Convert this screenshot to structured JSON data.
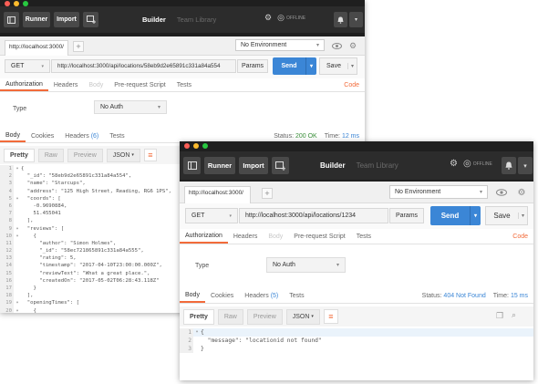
{
  "toolbar": {
    "runner_label": "Runner",
    "import_label": "Import",
    "builder_tab": "Builder",
    "team_library_tab": "Team Library",
    "offline_label": "OFFLINE"
  },
  "window1": {
    "url_tab": "http://localhost:3000/",
    "environment": "No Environment",
    "method": "GET",
    "url": "http://localhost:3000/api/locations/58eb9d2e65891c331a84a554",
    "params_label": "Params",
    "send_label": "Send",
    "save_label": "Save",
    "request_tabs": [
      "Authorization",
      "Headers",
      "Body",
      "Pre-request Script",
      "Tests"
    ],
    "code_link": "Code",
    "type_label": "Type",
    "auth_value": "No Auth",
    "response_tabs": [
      "Body",
      "Cookies",
      "Headers",
      "Tests"
    ],
    "headers_count": "(6)",
    "status_label": "Status:",
    "status_value": "200 OK",
    "time_label": "Time:",
    "time_value": "12 ms",
    "format_buttons": [
      "Pretty",
      "Raw",
      "Preview"
    ],
    "format_select": "JSON",
    "code_lines": [
      {
        "n": "1",
        "fold": "▾",
        "text": "{"
      },
      {
        "n": "2",
        "fold": "",
        "text": "  \"_id\": \"58eb9d2e65891c331a84a554\","
      },
      {
        "n": "3",
        "fold": "",
        "text": "  \"name\": \"Starcups\","
      },
      {
        "n": "4",
        "fold": "",
        "text": "  \"address\": \"125 High Street, Reading, RG6 1PS\","
      },
      {
        "n": "5",
        "fold": "▾",
        "text": "  \"coords\": ["
      },
      {
        "n": "6",
        "fold": "",
        "text": "    -0.9690884,"
      },
      {
        "n": "7",
        "fold": "",
        "text": "    51.455041"
      },
      {
        "n": "8",
        "fold": "",
        "text": "  ],"
      },
      {
        "n": "9",
        "fold": "▾",
        "text": "  \"reviews\": ["
      },
      {
        "n": "10",
        "fold": "▾",
        "text": "    {"
      },
      {
        "n": "11",
        "fold": "",
        "text": "      \"author\": \"Simon Holmes\","
      },
      {
        "n": "12",
        "fold": "",
        "text": "      \"_id\": \"58ec721865891c331a84a555\","
      },
      {
        "n": "13",
        "fold": "",
        "text": "      \"rating\": 5,"
      },
      {
        "n": "14",
        "fold": "",
        "text": "      \"timestamp\": \"2017-04-10T23:00:00.000Z\","
      },
      {
        "n": "15",
        "fold": "",
        "text": "      \"reviewText\": \"What a great place.\","
      },
      {
        "n": "16",
        "fold": "",
        "text": "      \"createdOn\": \"2017-05-02T06:28:43.118Z\""
      },
      {
        "n": "17",
        "fold": "",
        "text": "    }"
      },
      {
        "n": "18",
        "fold": "",
        "text": "  ],"
      },
      {
        "n": "19",
        "fold": "▾",
        "text": "  \"openingTimes\": ["
      },
      {
        "n": "20",
        "fold": "▾",
        "text": "    {"
      },
      {
        "n": "21",
        "fold": "",
        "text": "      \"days\": \"Monday - Friday\","
      },
      {
        "n": "22",
        "fold": "",
        "text": "      \"opening\": \"7:00am\","
      }
    ]
  },
  "window2": {
    "url_tab": "http://localhost:3000/",
    "environment": "No Environment",
    "method": "GET",
    "url": "http://localhost:3000/api/locations/1234",
    "params_label": "Params",
    "send_label": "Send",
    "save_label": "Save",
    "request_tabs": [
      "Authorization",
      "Headers",
      "Body",
      "Pre-request Script",
      "Tests"
    ],
    "code_link": "Code",
    "type_label": "Type",
    "auth_value": "No Auth",
    "response_tabs": [
      "Body",
      "Cookies",
      "Headers",
      "Tests"
    ],
    "headers_count": "(5)",
    "status_label": "Status:",
    "status_value": "404 Not Found",
    "time_label": "Time:",
    "time_value": "15 ms",
    "format_buttons": [
      "Pretty",
      "Raw",
      "Preview"
    ],
    "format_select": "JSON",
    "code_lines": [
      {
        "n": "1",
        "fold": "▾",
        "text": "{"
      },
      {
        "n": "2",
        "fold": "",
        "text": "  \"message\": \"locationid not found\""
      },
      {
        "n": "3",
        "fold": "",
        "text": "}"
      }
    ]
  },
  "colors": {
    "accent": "#f26b3a",
    "send": "#3b86d6",
    "titlebar": "#1f1f1f",
    "dot_red": "#fc5f57",
    "dot_yellow": "#fdbc2e",
    "dot_green": "#28c840"
  },
  "icons": [
    "sidebar-toggle-icon",
    "new-tab-icon",
    "sync-icon",
    "satellite-icon",
    "bell-icon",
    "chevron-down-icon",
    "eye-icon",
    "gear-icon",
    "wrap-icon",
    "copy-icon",
    "search-icon"
  ]
}
